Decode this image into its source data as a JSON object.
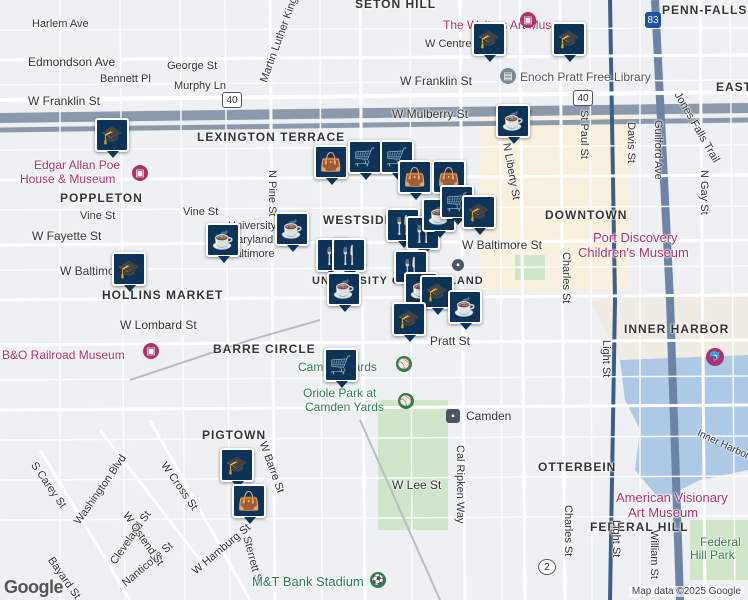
{
  "map": {
    "districts": [
      "SETON HILL",
      "PENN-FALLS",
      "LEXINGTON TERRACE",
      "POPPLETON",
      "WESTSIDE",
      "DOWNTOWN",
      "HOLLINS MARKET",
      "BARRE CIRCLE",
      "INNER HARBOR",
      "PIGTOWN",
      "OTTERBEIN",
      "FEDERAL HILL",
      "EAST",
      "UNIVERSITY OF MARYLAND"
    ],
    "streets": [
      "Harlem Ave",
      "Edmondson Ave",
      "George St",
      "Bennett Pl",
      "Murphy Ln",
      "W Franklin St",
      "W Franklin St",
      "W Mulberry St",
      "W Centre St",
      "N Pine St",
      "Vine St",
      "Vine St",
      "W Fayette St",
      "W Baltimore St",
      "W Baltimore St",
      "W Lombard St",
      "Pratt St",
      "Martin Luther King Jr Blvd",
      "N Liberty St",
      "St Paul St",
      "Davis St",
      "Guilford Ave",
      "Charles St",
      "Light St",
      "N Gay St",
      "Jones Falls Trail",
      "S Carey St",
      "Washington Blvd",
      "W Cross St",
      "Cleveland St",
      "Nanticoke St",
      "W Ostend St",
      "Bayard St",
      "W Hamburg St",
      "Sterrett St",
      "W Lee St",
      "Camden",
      "Cal Ripken Way",
      "Charles St",
      "Light St",
      "William St",
      "W Barre St",
      "Inner Harbor"
    ],
    "pois": {
      "walters": "The Walters Art Museum",
      "pratt": "Enoch Pratt Free Library",
      "poe_line1": "Edgar Allan Poe",
      "poe_line2": "House & Museum",
      "bo": "B&O Railroad Museum",
      "camden_yards": "Camden Yards",
      "oriole_line1": "Oriole Park at",
      "oriole_line2": "Camden Yards",
      "port_line1": "Port Discovery",
      "port_line2": "Children's Museum",
      "avam_line1": "American Visionary",
      "avam_line2": "Art Museum",
      "fed_line1": "Federal",
      "fed_line2": "Hill Park",
      "mt_bank": "M&T Bank Stadium",
      "university_line1": "University of",
      "university_line2": "Maryland",
      "university_line3": "Baltimore"
    },
    "shields": [
      "40",
      "40",
      "83",
      "2"
    ],
    "footer": "Map data ©2025 Google",
    "logo": "Google"
  },
  "markers": [
    {
      "icon": "graduation-cap-icon",
      "glyph": "🎓"
    },
    {
      "icon": "graduation-cap-icon",
      "glyph": "🎓"
    },
    {
      "icon": "graduation-cap-icon",
      "glyph": "🎓"
    },
    {
      "icon": "coffee-cup-icon",
      "glyph": "☕"
    },
    {
      "icon": "graduation-cap-icon",
      "glyph": "🎓"
    },
    {
      "icon": "shopping-bag-icon",
      "glyph": "👜"
    },
    {
      "icon": "shopping-cart-icon",
      "glyph": "🛒"
    },
    {
      "icon": "shopping-cart-icon",
      "glyph": "🛒"
    },
    {
      "icon": "shopping-bag-icon",
      "glyph": "👜"
    },
    {
      "icon": "shopping-bag-icon",
      "glyph": "👜"
    },
    {
      "icon": "coffee-cup-icon",
      "glyph": "☕"
    },
    {
      "icon": "coffee-cup-icon",
      "glyph": "☕"
    },
    {
      "icon": "restaurant-icon",
      "glyph": "🍴"
    },
    {
      "icon": "restaurant-icon",
      "glyph": "🍴"
    },
    {
      "icon": "coffee-cup-icon",
      "glyph": "☕"
    },
    {
      "icon": "restaurant-icon",
      "glyph": "🍴"
    },
    {
      "icon": "restaurant-icon",
      "glyph": "🍴"
    },
    {
      "icon": "restaurant-icon",
      "glyph": "🍴"
    },
    {
      "icon": "coffee-cup-icon",
      "glyph": "☕"
    },
    {
      "icon": "coffee-cup-icon",
      "glyph": "☕"
    },
    {
      "icon": "shopping-cart-icon",
      "glyph": "🛒"
    },
    {
      "icon": "graduation-cap-icon",
      "glyph": "🎓"
    },
    {
      "icon": "graduation-cap-icon",
      "glyph": "🎓"
    },
    {
      "icon": "graduation-cap-icon",
      "glyph": "🎓"
    },
    {
      "icon": "shopping-cart-icon",
      "glyph": "🛒"
    },
    {
      "icon": "graduation-cap-icon",
      "glyph": "🎓"
    },
    {
      "icon": "coffee-cup-icon",
      "glyph": "☕"
    },
    {
      "icon": "shopping-bag-icon",
      "glyph": "👜"
    }
  ]
}
